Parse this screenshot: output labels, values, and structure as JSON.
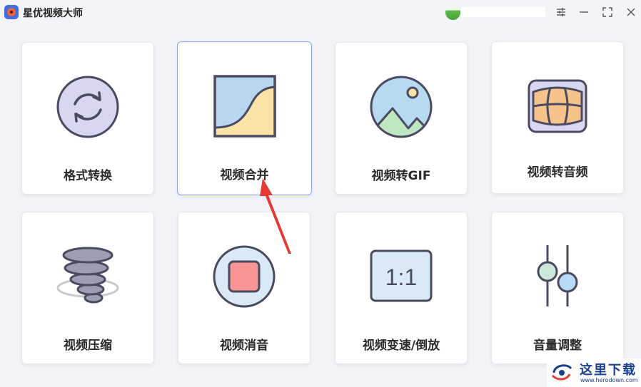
{
  "app": {
    "title": "星优视频大师",
    "icon": "app-logo-icon"
  },
  "window_controls": [
    {
      "name": "settings-icon"
    },
    {
      "name": "minimize-icon"
    },
    {
      "name": "maximize-icon"
    },
    {
      "name": "close-icon"
    }
  ],
  "tools": [
    {
      "label": "格式转换",
      "icon": "convert-icon"
    },
    {
      "label": "视频合并",
      "icon": "merge-icon",
      "selected": true
    },
    {
      "label": "视频转GIF",
      "icon": "image-icon"
    },
    {
      "label": "视频转音频",
      "icon": "audio-icon"
    },
    {
      "label": "视频压缩",
      "icon": "tornado-icon"
    },
    {
      "label": "视频消音",
      "icon": "mute-icon"
    },
    {
      "label": "视频变速/倒放",
      "icon": "ratio-icon"
    },
    {
      "label": "音量调整",
      "icon": "sliders-icon"
    }
  ],
  "watermark": {
    "title": "这里下载",
    "url": "www.herodown.com"
  },
  "colors": {
    "accent": "#3d6fe0",
    "selected_border": "#8aa6ec",
    "icon_stroke": "#4a4a60",
    "arrow": "#e53935"
  }
}
